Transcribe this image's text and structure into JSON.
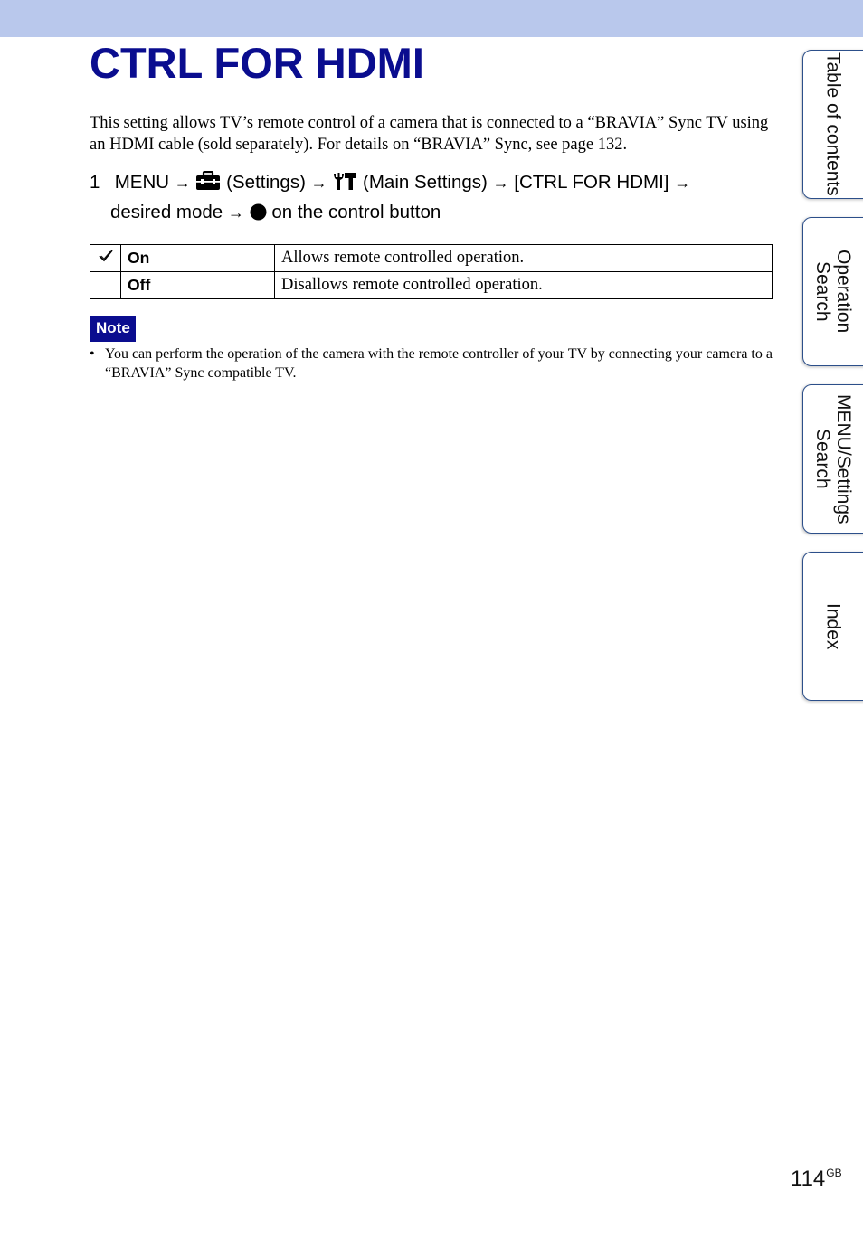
{
  "header": {
    "title": "CTRL FOR HDMI"
  },
  "intro": "This setting allows TV’s remote control of a camera that is connected to a “BRAVIA” Sync TV using an HDMI cable (sold separately). For details on “BRAVIA” Sync, see page 132.",
  "step": {
    "number": "1",
    "menu": "MENU",
    "arrow": "→",
    "settings_icon": "toolbox-icon",
    "settings_label": "(Settings)",
    "main_settings_icon": "wrench-hammer-icon",
    "main_settings_label": "(Main Settings)",
    "item": "[CTRL FOR HDMI]",
    "desired": "desired mode",
    "control_icon": "filled-circle-icon",
    "control_text": "on the control button"
  },
  "options": [
    {
      "selected": true,
      "name": "On",
      "description": "Allows remote controlled operation."
    },
    {
      "selected": false,
      "name": "Off",
      "description": "Disallows remote controlled operation."
    }
  ],
  "note": {
    "label": "Note",
    "items": [
      "You can perform the operation of the camera with the remote controller of your TV by connecting your camera to a “BRAVIA” Sync compatible TV."
    ]
  },
  "side_tabs": [
    {
      "label": "Table of contents"
    },
    {
      "label": "Operation Search"
    },
    {
      "label": "MENU/Settings Search"
    },
    {
      "label": "Index"
    }
  ],
  "footer": {
    "page": "114",
    "suffix": "GB"
  },
  "colors": {
    "band": "#b9c8ec",
    "title": "#0a0d8f",
    "tab_border": "#2c4f8a"
  }
}
